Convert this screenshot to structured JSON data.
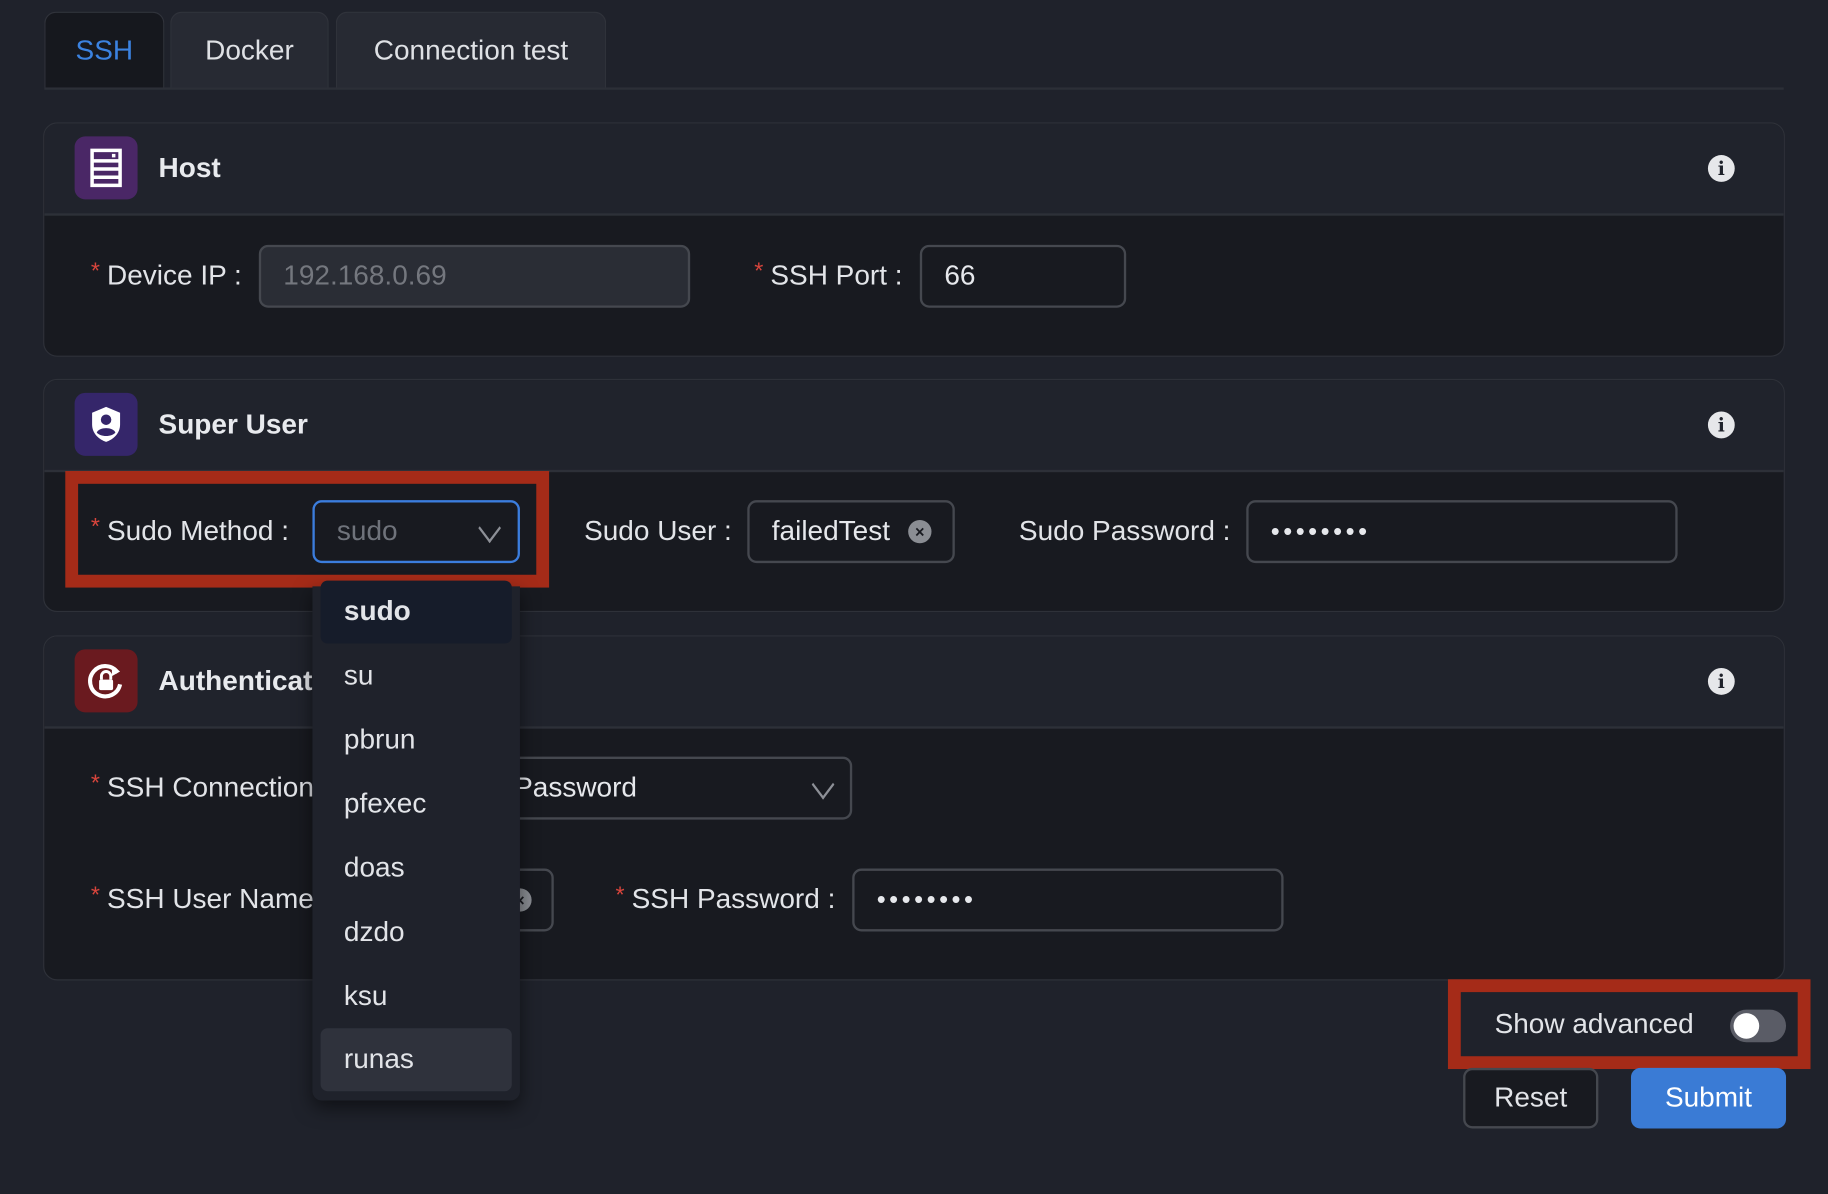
{
  "tabs": [
    {
      "label": "SSH",
      "active": true
    },
    {
      "label": "Docker",
      "active": false
    },
    {
      "label": "Connection test",
      "active": false
    }
  ],
  "host": {
    "title": "Host",
    "icon": "server-icon",
    "device_ip_label": "Device IP :",
    "device_ip_value": "192.168.0.69",
    "ssh_port_label": "SSH Port :",
    "ssh_port_value": "66"
  },
  "super_user": {
    "title": "Super User",
    "icon": "shield-user-icon",
    "sudo_method_label": "Sudo Method :",
    "sudo_method_value": "sudo",
    "sudo_user_label": "Sudo User :",
    "sudo_user_value": "failedTest",
    "sudo_password_label": "Sudo Password :",
    "sudo_password_value": "••••••••"
  },
  "sudo_method_options": [
    {
      "label": "sudo",
      "selected": true
    },
    {
      "label": "su"
    },
    {
      "label": "pbrun"
    },
    {
      "label": "pfexec"
    },
    {
      "label": "doas"
    },
    {
      "label": "dzdo"
    },
    {
      "label": "ksu"
    },
    {
      "label": "runas",
      "hovered": true
    }
  ],
  "authentication": {
    "title": "Authentication",
    "icon": "lock-rotate-icon",
    "ssh_connection_label": "SSH Connection",
    "ssh_connection_value": "Password",
    "ssh_user_name_label": "SSH User Name",
    "ssh_password_label": "SSH Password :",
    "ssh_password_value": "••••••••"
  },
  "footer": {
    "show_advanced_label": "Show advanced",
    "show_advanced_on": false,
    "reset_label": "Reset",
    "submit_label": "Submit"
  },
  "colors": {
    "accent": "#3a7bd5",
    "highlight_box": "#a52b18",
    "required": "#d9453c"
  }
}
